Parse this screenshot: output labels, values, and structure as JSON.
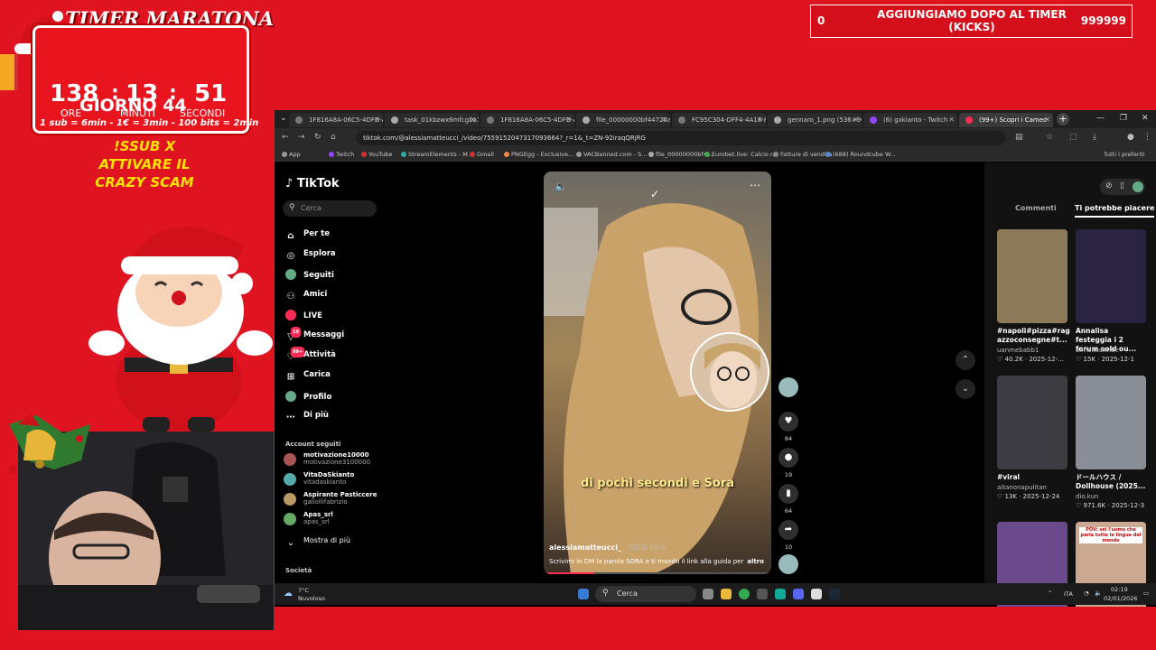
{
  "overlay": {
    "timer_title": "TIMER MARATONA",
    "hours": "138",
    "hours_label": "ORE",
    "minutes": "13",
    "minutes_label": "MINUTI",
    "seconds": "51",
    "seconds_label": "SECONDI",
    "day": "GIORNO 44",
    "rates": "1 sub = 6min - 1€ = 3min - 100 bits = 2min",
    "sub_line1": "!SSUB X",
    "sub_line2": "ATTIVARE IL",
    "sub_line3": "CRAZY SCAM",
    "banner_left": "0",
    "banner_center": "AGGIUNGIAMO DOPO AL TIMER (KICKS)",
    "banner_right": "999999"
  },
  "browser": {
    "tabs": [
      {
        "label": "1F816A8A-06C5-4DFD-A"
      },
      {
        "label": "task_01kbzwx6mfcgba7"
      },
      {
        "label": "1F816A8A-06C5-4DFD-A"
      },
      {
        "label": "file_00000000bf44720aa"
      },
      {
        "label": "FC95C304-DFF4-4A18-8"
      },
      {
        "label": "gennaro_1.png (536×960)"
      },
      {
        "label": "(6) gxkianto - Twitch"
      },
      {
        "label": "(99+) Scopri i Cameo"
      }
    ],
    "url": "tiktok.com/@alessiamatteucci_/video/7559152047317093664?_r=1&_t=ZN-92iraqQRjRG",
    "bookmarks": [
      "App",
      "Twitch",
      "YouTube",
      "StreamElements - M...",
      "Gmail",
      "PNGEgg - Exclusive...",
      "VACBanned.com - S...",
      "file_00000000bf4...",
      "Eurobet.live: Calcio r...",
      "Fatture di vendita",
      "(688) Roundcube W..."
    ],
    "bookmarks_right": "Tutti i preferiti"
  },
  "tiktok": {
    "logo": "TikTok",
    "search_placeholder": "Cerca",
    "menu": [
      {
        "label": "Per te",
        "icon": "home-icon"
      },
      {
        "label": "Esplora",
        "icon": "compass-icon"
      },
      {
        "label": "Seguiti",
        "icon": "avatar-icon"
      },
      {
        "label": "Amici",
        "icon": "friends-icon"
      },
      {
        "label": "LIVE",
        "icon": "live-icon"
      },
      {
        "label": "Messaggi",
        "icon": "message-icon",
        "badge": "19"
      },
      {
        "label": "Attività",
        "icon": "activity-icon",
        "badge": "99+"
      },
      {
        "label": "Carica",
        "icon": "upload-icon"
      },
      {
        "label": "Profilo",
        "icon": "profile-icon"
      },
      {
        "label": "Di più",
        "icon": "more-icon"
      }
    ],
    "followed_title": "Account seguiti",
    "accounts": [
      {
        "name": "motivazione10000",
        "handle": "motivazione3100000"
      },
      {
        "name": "VitaDaSkianto",
        "handle": "vitadaskianto"
      },
      {
        "name": "Aspirante Pasticcere",
        "handle": "gallollifabrizio"
      },
      {
        "name": "Apas_srl",
        "handle": "apas_srl"
      }
    ],
    "show_more": "Mostra di più",
    "footer_section": "Società",
    "video": {
      "caption": "di pochi secondi e Sora",
      "author": "alessiamatteucci_",
      "date": " · 2025-10-9",
      "description": "Scrivimi in DM la parola SORA e ti mando il link alla guida per",
      "more": "altro",
      "progress": 0.22,
      "likes": "84",
      "comments": "19",
      "saves": "64",
      "shares": "10"
    },
    "right_tabs": [
      "Commenti",
      "Ti potrebbe piacere"
    ],
    "suggestions": [
      {
        "title": "#napoli#pizza#rag azzoconsegne#t...",
        "user": "uanmebabb1",
        "stats": "♡ 40.2K · 2025-12-...",
        "color": "#8d7a5a"
      },
      {
        "title": "Annalisa festeggia i 2 forum sold ou...",
        "user": "annalisa.tribe",
        "stats": "♡ 15K · 2025-12-1",
        "color": "#2a2440"
      },
      {
        "title": "#viral",
        "user": "aitanonapulitan",
        "stats": "♡ 13K · 2025-12-24",
        "color": "#3c3c42"
      },
      {
        "title": "ドールハウス / Dollhouse (2025...",
        "user": "dio.kun",
        "stats": "♡ 971.6K · 2025-12-3",
        "color": "#8a8f96"
      },
      {
        "title": "",
        "user": "",
        "stats": "",
        "color": "#6a4a8a"
      },
      {
        "title": "POV: sei l'uomo che parla tutte le lingue del mondo",
        "user": "",
        "stats": "",
        "color": "#caa892"
      }
    ]
  },
  "taskbar": {
    "weather_temp": "7°C",
    "weather_desc": "Nuvoloso",
    "search": "Cerca",
    "lang": "ITA",
    "time": "02:19",
    "date": "02/01/2026"
  },
  "colors": {
    "accent": "#e01420",
    "tiktok_red": "#fe2c55",
    "sub_yellow": "#ffe300"
  }
}
